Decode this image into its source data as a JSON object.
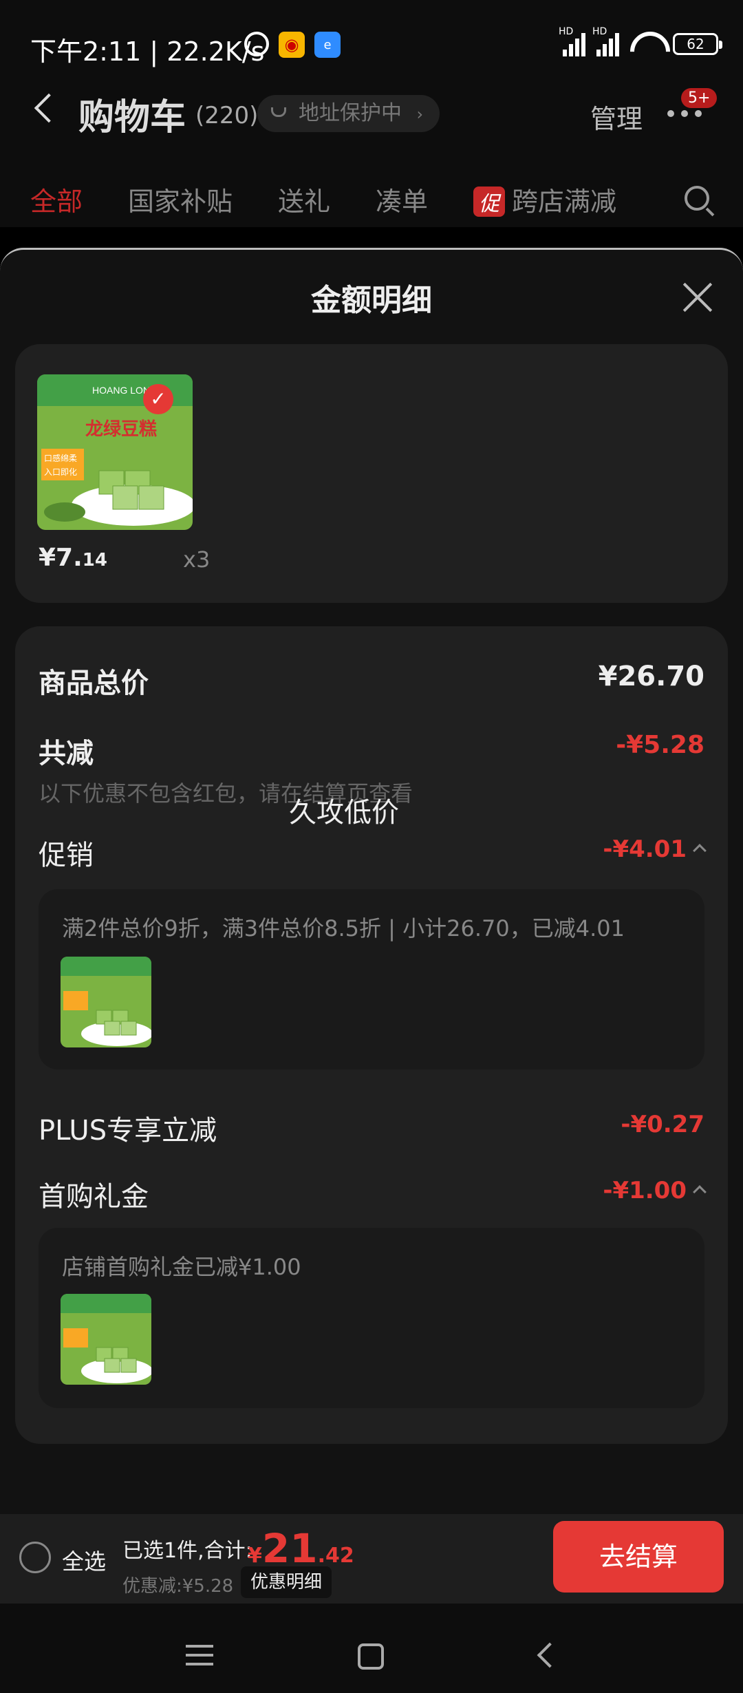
{
  "status_bar": {
    "time": "下午2:11 | 22.2K/s",
    "signal1_label": "HD",
    "signal2_label": "HD",
    "battery": "62"
  },
  "header": {
    "title": "购物车",
    "count": "(220)",
    "address_label": "地址保护中",
    "address_chevron": "›",
    "manage": "管理",
    "badge": "5+"
  },
  "tabs": [
    {
      "label": "全部"
    },
    {
      "label": "国家补贴"
    },
    {
      "label": "送礼"
    },
    {
      "label": "凑单"
    },
    {
      "label": "跨店满减",
      "badge": "促"
    }
  ],
  "sheet": {
    "title": "金额明细"
  },
  "product": {
    "price_main": "¥7.",
    "price_cents": "14",
    "qty": "x3",
    "image_text_1": "HOANG LONG",
    "image_text_2": "龙绿豆糕",
    "image_text_3": "口感绵柔",
    "image_text_4": "入口即化"
  },
  "details": {
    "total_label": "商品总价",
    "total_value": "¥26.70",
    "reduce_label": "共减",
    "reduce_value": "-¥5.28",
    "reduce_note": "以下优惠不包含红包，请在结算页查看",
    "overlay": "久攻低价",
    "promo_label": "促销",
    "promo_value": "-¥4.01",
    "promo_desc": "满2件总价9折，满3件总价8.5折 | 小计26.70，已减4.01",
    "plus_label": "PLUS专享立减",
    "plus_value": "-¥0.27",
    "gift_label": "首购礼金",
    "gift_value": "-¥1.00",
    "gift_desc": "店铺首购礼金已减¥1.00"
  },
  "bottom": {
    "select_all": "全选",
    "selected": "已选1件,合计:",
    "total_yen": "¥",
    "total_main": "21",
    "total_cents": ".42",
    "discount": "优惠减:¥5.28",
    "discount_btn": "优惠明细",
    "checkout": "去结算"
  },
  "colors": {
    "accent": "#e53935",
    "background": "#000000",
    "card": "#202020"
  }
}
